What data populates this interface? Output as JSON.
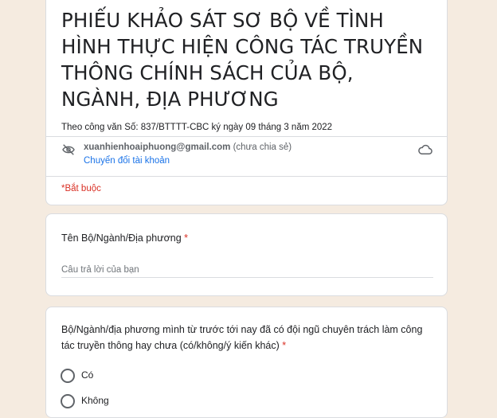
{
  "form": {
    "title": "PHIẾU KHẢO SÁT SƠ BỘ VỀ TÌNH HÌNH THỰC HIỆN CÔNG TÁC TRUYỀN THÔNG CHÍNH SÁCH CỦA BỘ, NGÀNH, ĐỊA PHƯƠNG",
    "description": "Theo công văn Số:  837/BTTTT-CBC  ký ngày 09 tháng 3 năm 2022",
    "required_note": "*Bắt buộc"
  },
  "account": {
    "email": "xuanhienhoaiphuong@gmail.com",
    "status": "(chưa chia sẻ)",
    "switch_label": "Chuyển đổi tài khoản",
    "icons": {
      "visibility": "eye-off-icon",
      "cloud": "cloud-save-icon"
    }
  },
  "questions": [
    {
      "label": "Tên Bộ/Ngành/Địa phương",
      "required_mark": "*",
      "placeholder": "Câu trả lời của bạn"
    },
    {
      "label": "Bộ/Ngành/địa phương mình từ trước tới nay đã có đội ngũ chuyên trách làm công tác truyền thông hay chưa (có/không/ý kiến khác)",
      "required_mark": "*",
      "options": [
        "Có",
        "Không"
      ]
    }
  ],
  "colors": {
    "background": "#f5ebe0",
    "required": "#d93025",
    "link": "#1a73e8"
  }
}
